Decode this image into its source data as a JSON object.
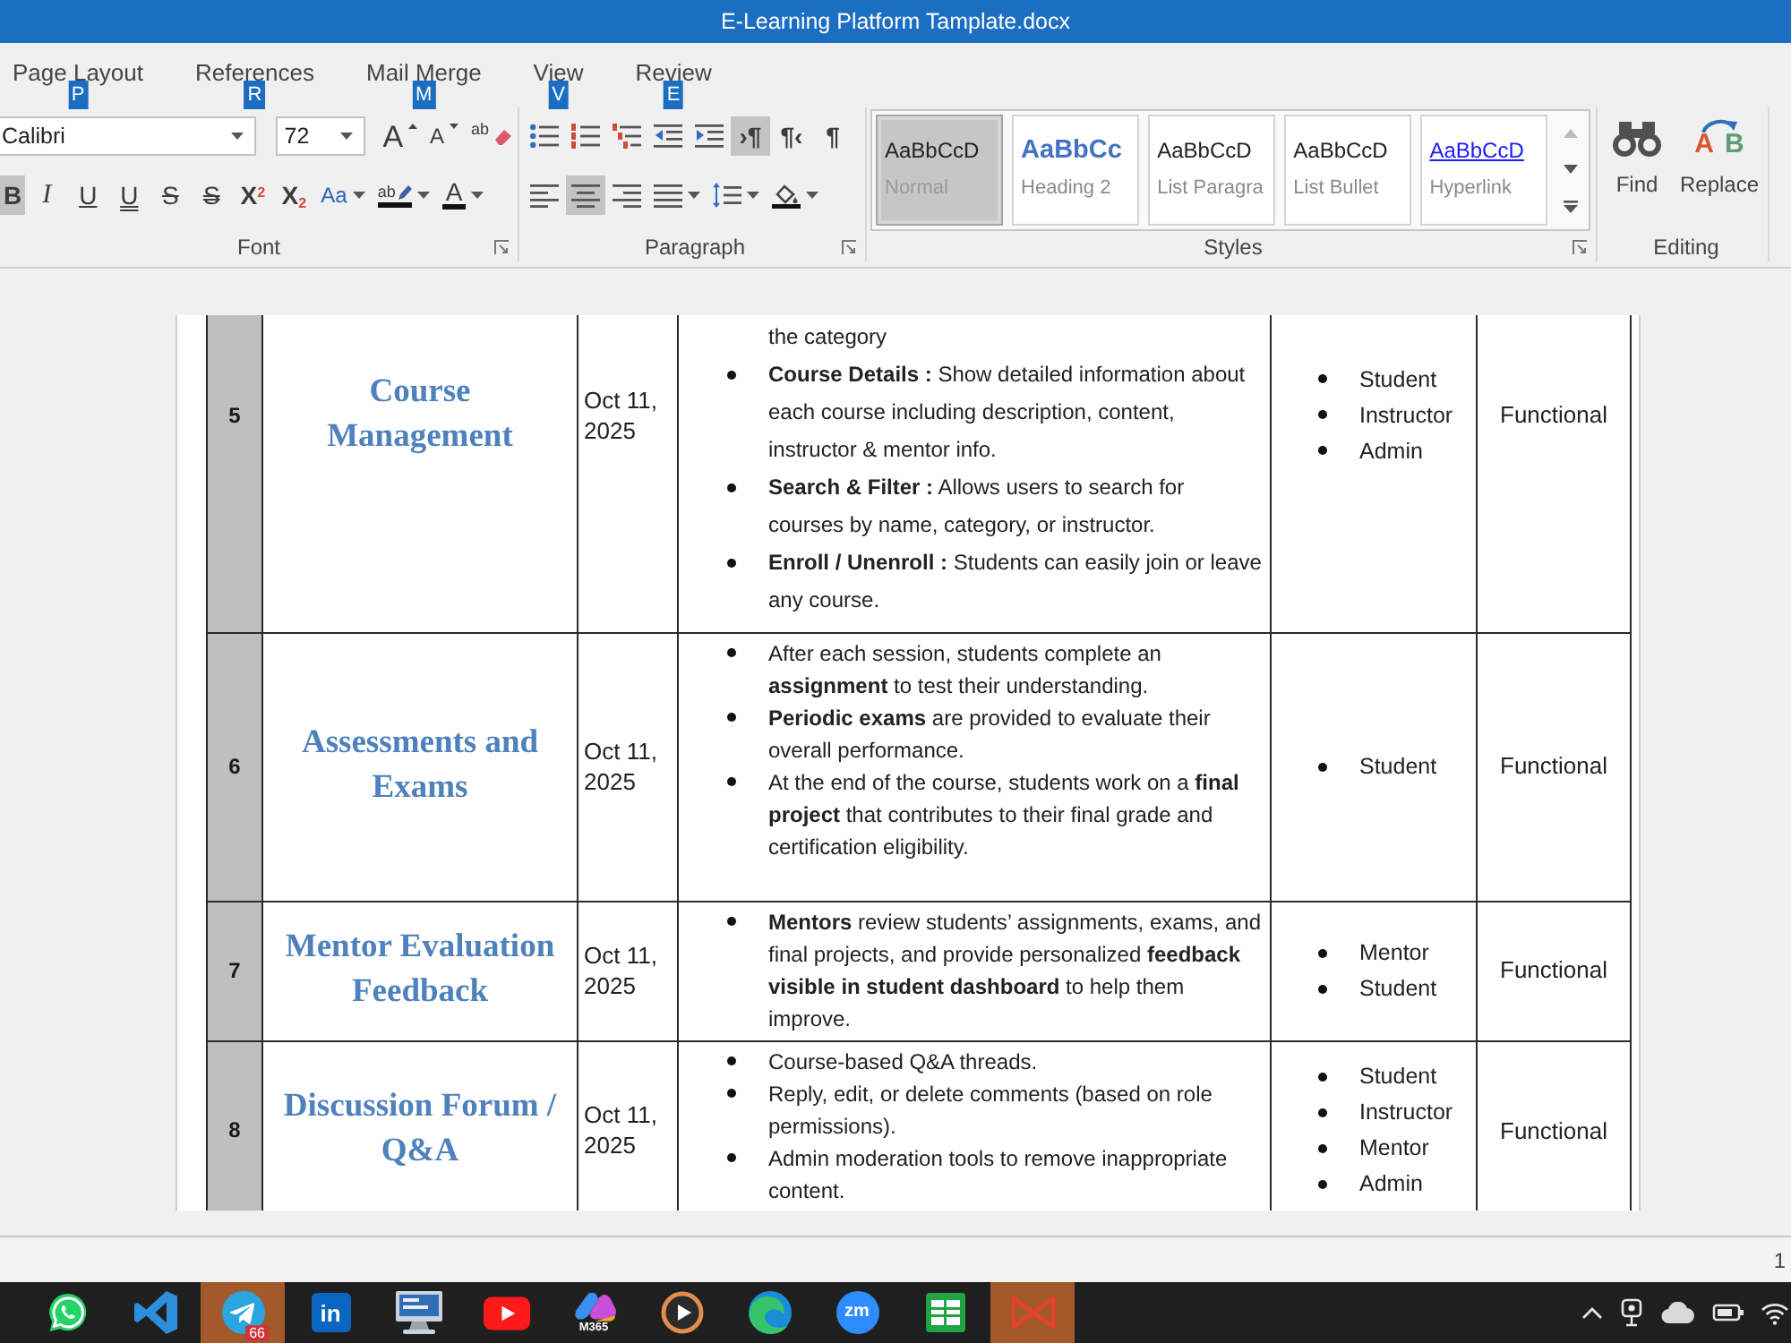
{
  "window": {
    "title": "E-Learning Platform Tamplate.docx"
  },
  "ribbon_tabs": [
    {
      "label": "Page Layout",
      "keytip": "P",
      "selected": false
    },
    {
      "label": "References",
      "keytip": "R",
      "selected": false
    },
    {
      "label": "Mail Merge",
      "keytip": "M",
      "selected": false
    },
    {
      "label": "View",
      "keytip": "V",
      "selected": false
    },
    {
      "label": "Review",
      "keytip": "E",
      "selected": false
    }
  ],
  "font_group": {
    "label": "Font",
    "font_name": "Calibri",
    "font_size": "72",
    "row1": [
      {
        "kind": "grow",
        "glyph": "A"
      },
      {
        "kind": "shrink",
        "glyph": "A"
      },
      {
        "kind": "clear",
        "glyph": "ab"
      }
    ],
    "row2": [
      {
        "kind": "bold",
        "glyph": "B",
        "selected": true,
        "dropdown": false
      },
      {
        "kind": "italic",
        "glyph": "I",
        "selected": false,
        "dropdown": false
      },
      {
        "kind": "underline",
        "glyph": "U",
        "selected": false,
        "dropdown": false
      },
      {
        "kind": "double-underline",
        "glyph": "U",
        "selected": false,
        "dropdown": false
      },
      {
        "kind": "strike",
        "glyph": "S",
        "selected": false,
        "dropdown": false
      },
      {
        "kind": "double-strike",
        "glyph": "S",
        "selected": false,
        "dropdown": false
      },
      {
        "kind": "superscript",
        "glyph": "X$^{2}$",
        "selected": false,
        "dropdown": false
      },
      {
        "kind": "subscript",
        "glyph": "X$_{2}$",
        "selected": false,
        "dropdown": false
      },
      {
        "kind": "case",
        "glyph": "Aa",
        "selected": false,
        "dropdown": true
      },
      {
        "kind": "highlight",
        "glyph": "ab",
        "selected": false,
        "dropdown": true
      },
      {
        "kind": "font-color",
        "glyph": "A",
        "selected": false,
        "dropdown": true
      }
    ]
  },
  "paragraph_group": {
    "label": "Paragraph",
    "row1": [
      {
        "kind": "bullets",
        "selected": false
      },
      {
        "kind": "numbering",
        "selected": false
      },
      {
        "kind": "multilevel",
        "selected": false
      },
      {
        "kind": "outdent",
        "selected": false
      },
      {
        "kind": "indent",
        "selected": false
      },
      {
        "kind": "ltr",
        "glyph": "›¶",
        "selected": true
      },
      {
        "kind": "rtl",
        "glyph": "¶‹",
        "selected": false
      },
      {
        "kind": "marks",
        "glyph": "¶",
        "selected": false
      }
    ],
    "row2": [
      {
        "kind": "align-left",
        "selected": false,
        "dropdown": false
      },
      {
        "kind": "align-center",
        "selected": true,
        "dropdown": false
      },
      {
        "kind": "align-right",
        "selected": false,
        "dropdown": false
      },
      {
        "kind": "justify",
        "selected": false,
        "dropdown": true
      },
      {
        "kind": "line-spacing",
        "selected": false,
        "dropdown": true
      },
      {
        "kind": "shading",
        "selected": false,
        "dropdown": true
      }
    ]
  },
  "styles_group": {
    "label": "Styles",
    "items": [
      {
        "preview": "AaBbCcD",
        "name": "Normal",
        "kind": "normal",
        "selected": true
      },
      {
        "preview": "AaBbCc",
        "name": "Heading 2",
        "kind": "heading",
        "selected": false
      },
      {
        "preview": "AaBbCcD",
        "name": "List Paragra",
        "kind": "normal",
        "selected": false
      },
      {
        "preview": "AaBbCcD",
        "name": "List Bullet",
        "kind": "normal",
        "selected": false
      },
      {
        "preview": "AaBbCcD",
        "name": "Hyperlink",
        "kind": "link",
        "selected": false
      }
    ]
  },
  "editing_group": {
    "label": "Editing",
    "buttons": [
      {
        "kind": "find",
        "label": "Find"
      },
      {
        "kind": "replace",
        "label": "Replace",
        "icon_letters": [
          "A",
          "B"
        ]
      }
    ]
  },
  "table": {
    "rows": [
      {
        "number": "5",
        "feature": "Course Management",
        "date": "Oct 11, 2025",
        "description": [
          {
            "text": "the category",
            "bullet": false
          },
          {
            "text": "**Course Details :** Show detailed information about each course including description, content, instructor & mentor info.",
            "bullet": true
          },
          {
            "text": "**Search & Filter :** Allows users to search for courses by name, category, or instructor.",
            "bullet": true
          },
          {
            "text": "**Enroll / Unenroll :** Students can easily join or leave any course.",
            "bullet": true
          }
        ],
        "roles": [
          "Student",
          "Instructor",
          "Admin"
        ],
        "type": "Functional"
      },
      {
        "number": "6",
        "feature": "Assessments and Exams",
        "date": "Oct 11, 2025",
        "description": [
          {
            "text": "After each session, students complete an **assignment** to test their understanding.",
            "bullet": true
          },
          {
            "text": "**Periodic exams** are provided to evaluate their overall performance.",
            "bullet": true
          },
          {
            "text": "At the end of the course, students work on a **final project** that contributes to their final grade and certification eligibility.",
            "bullet": true
          }
        ],
        "roles": [
          "Student"
        ],
        "type": "Functional"
      },
      {
        "number": "7",
        "feature": "Mentor Evaluation Feedback",
        "date": "Oct 11, 2025",
        "description": [
          {
            "text": "**Mentors** review students’ assignments, exams, and final projects, and provide personalized **feedback visible in student dashboard** to help them improve.",
            "bullet": true
          }
        ],
        "roles": [
          "Mentor",
          "Student"
        ],
        "type": "Functional"
      },
      {
        "number": "8",
        "feature": "Discussion Forum / Q&A",
        "date": "Oct 11, 2025",
        "description": [
          {
            "text": "Course-based Q&A threads.",
            "bullet": true
          },
          {
            "text": "Reply, edit, or delete comments (based on role permissions).",
            "bullet": true
          },
          {
            "text": "Admin moderation tools to remove inappropriate content.",
            "bullet": true
          }
        ],
        "roles": [
          "Student",
          "Instructor",
          "Mentor",
          "Admin"
        ],
        "type": "Functional"
      }
    ]
  },
  "status_bar": {
    "page": "1"
  },
  "taskbar": {
    "apps": [
      {
        "kind": "phone-bubble",
        "flashing": false
      },
      {
        "kind": "ribbon",
        "flashing": false
      },
      {
        "kind": "paper-plane",
        "flashing": true,
        "badge": "66"
      },
      {
        "kind": "letter-tile",
        "glyph": "in",
        "flashing": false
      },
      {
        "kind": "monitor",
        "flashing": false
      },
      {
        "kind": "play-tile",
        "flashing": false
      },
      {
        "kind": "swirl",
        "caption": "M365",
        "flashing": false
      },
      {
        "kind": "play-circle",
        "flashing": false
      },
      {
        "kind": "wave-circle",
        "flashing": false
      },
      {
        "kind": "letter-circle",
        "glyph": "zm",
        "flashing": false
      },
      {
        "kind": "sheet-tile",
        "flashing": false
      },
      {
        "kind": "bowtie",
        "flashing": true
      }
    ],
    "tray": [
      {
        "kind": "chevron"
      },
      {
        "kind": "webcam"
      },
      {
        "kind": "cloud"
      },
      {
        "kind": "battery"
      },
      {
        "kind": "wifi"
      }
    ]
  }
}
